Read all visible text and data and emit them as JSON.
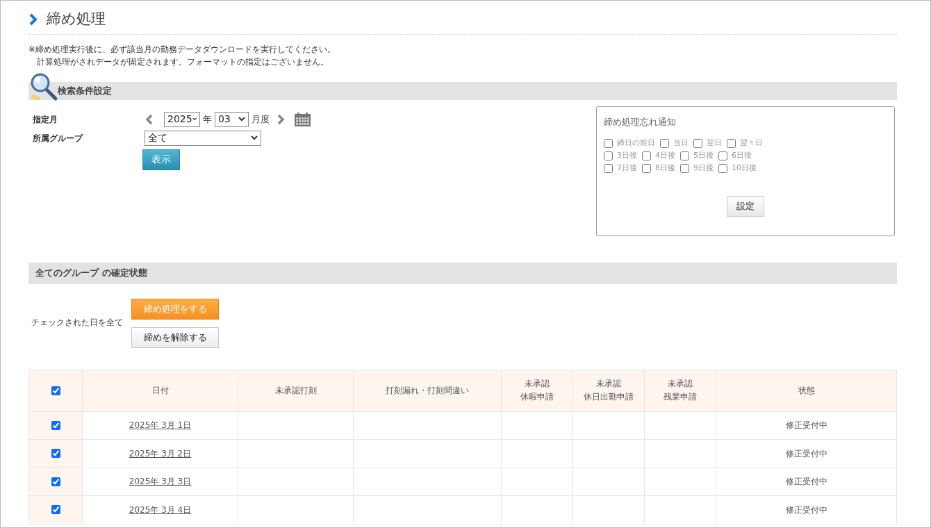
{
  "page_title": "締め処理",
  "notes": [
    "※締め処理実行後に、必ず該当月の勤務データダウンロードを実行してください。",
    "計算処理がされデータが固定されます。フォーマットの指定はございません。"
  ],
  "search": {
    "title": "検索条件設定",
    "month_label": "指定月",
    "year": "2025",
    "year_unit": "年",
    "month": "03",
    "month_unit": "月度",
    "group_label": "所属グループ",
    "group": "全て",
    "show_button": "表示"
  },
  "notify": {
    "title": "締め処理忘れ通知",
    "options": [
      [
        {
          "label": "締日の前日",
          "checked": false
        },
        {
          "label": "当日",
          "checked": false
        },
        {
          "label": "翌日",
          "checked": false
        },
        {
          "label": "翌々日",
          "checked": false
        }
      ],
      [
        {
          "label": "3日後",
          "checked": false
        },
        {
          "label": "4日後",
          "checked": false
        },
        {
          "label": "5日後",
          "checked": false
        },
        {
          "label": "6日後",
          "checked": false
        }
      ],
      [
        {
          "label": "7日後",
          "checked": false
        },
        {
          "label": "8日後",
          "checked": false
        },
        {
          "label": "9日後",
          "checked": false
        },
        {
          "label": "10日後",
          "checked": false
        }
      ]
    ],
    "button": "設定"
  },
  "status_section": {
    "title": "全てのグループ の確定状態",
    "actions_label": "チェックされた日を全て",
    "close_button": "締め処理をする",
    "release_button": "締めを解除する"
  },
  "table": {
    "all_checked": true,
    "columns": [
      [
        "日付"
      ],
      [
        "未承認打刻"
      ],
      [
        "打刻漏れ・打刻間違い"
      ],
      [
        "未承認",
        "休暇申請"
      ],
      [
        "未承認",
        "休日出勤申請"
      ],
      [
        "未承認",
        "残業申請"
      ],
      [
        "状態"
      ]
    ],
    "rows": [
      {
        "checked": true,
        "date": "2025年 3月 1日",
        "status": "修正受付中"
      },
      {
        "checked": true,
        "date": "2025年 3月 2日",
        "status": "修正受付中"
      },
      {
        "checked": true,
        "date": "2025年 3月 3日",
        "status": "修正受付中"
      },
      {
        "checked": true,
        "date": "2025年 3月 4日",
        "status": "修正受付中"
      }
    ]
  }
}
